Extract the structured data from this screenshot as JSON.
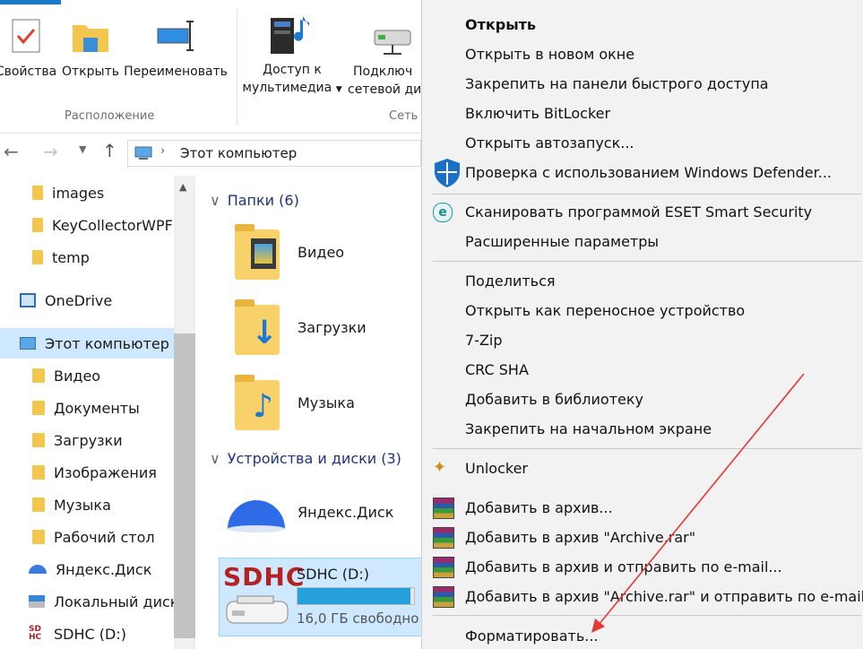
{
  "ribbon": {
    "buttons": {
      "properties": "Свойства",
      "open": "Открыть",
      "rename": "Переименовать",
      "media_access_line1": "Доступ к",
      "media_access_line2": "мультимедиа",
      "connect_line1": "Подключ",
      "connect_line2": "сетевой ди"
    },
    "groups": {
      "location": "Расположение",
      "network": "Сеть"
    }
  },
  "address": {
    "path": "Этот компьютер"
  },
  "nav": {
    "items": [
      {
        "label": "images",
        "icon": "folder-icon"
      },
      {
        "label": "KeyCollectorWPF",
        "icon": "folder-icon"
      },
      {
        "label": "temp",
        "icon": "folder-icon"
      },
      {
        "label": "OneDrive",
        "icon": "onedrive-icon"
      },
      {
        "label": "Этот компьютер",
        "icon": "computer-icon"
      },
      {
        "label": "Видео",
        "icon": "video-folder-icon"
      },
      {
        "label": "Документы",
        "icon": "documents-folder-icon"
      },
      {
        "label": "Загрузки",
        "icon": "downloads-folder-icon"
      },
      {
        "label": "Изображения",
        "icon": "pictures-folder-icon"
      },
      {
        "label": "Музыка",
        "icon": "music-folder-icon"
      },
      {
        "label": "Рабочий стол",
        "icon": "desktop-folder-icon"
      },
      {
        "label": "Яндекс.Диск",
        "icon": "yandex-disk-icon"
      },
      {
        "label": "Локальный диск",
        "icon": "local-disk-icon"
      },
      {
        "label": "SDHC (D:)",
        "icon": "sdhc-icon"
      }
    ]
  },
  "content": {
    "folders_header": "Папки (6)",
    "folders": [
      "Видео",
      "Загрузки",
      "Музыка"
    ],
    "devices_header": "Устройства и диски (3)",
    "devices": [
      {
        "name": "Яндекс.Диск"
      },
      {
        "name": "SDHC (D:)",
        "free": "16,0 ГБ свободно",
        "usage": 0.97,
        "logo": "SDHC"
      }
    ]
  },
  "menu": {
    "items": [
      "Открыть",
      "Открыть в новом окне",
      "Закрепить на панели быстрого доступа",
      "Включить BitLocker",
      "Открыть автозапуск...",
      "Проверка с использованием Windows Defender...",
      "Сканировать программой ESET Smart Security",
      "Расширенные параметры",
      "Поделиться",
      "Открыть как переносное устройство",
      "7-Zip",
      "CRC SHA",
      "Добавить в библиотеку",
      "Закрепить на начальном экране",
      "Unlocker",
      "Добавить в архив...",
      "Добавить в архив \"Archive.rar\"",
      "Добавить в архив и отправить по e-mail...",
      "Добавить в архив \"Archive.rar\" и отправить по e-mail",
      "Форматировать..."
    ]
  },
  "colors": {
    "accent": "#1979ca",
    "selection": "#cde8ff",
    "annotation_arrow": "#e53935"
  }
}
